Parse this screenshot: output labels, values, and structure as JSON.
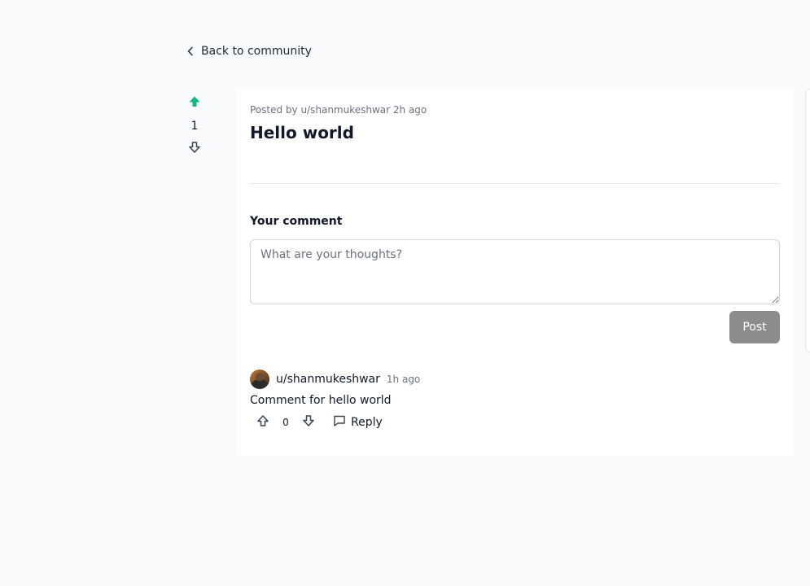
{
  "nav": {
    "back_label": "Back to community"
  },
  "post": {
    "meta": "Posted by u/shanmukeshwar 2h ago",
    "title": "Hello world",
    "votes": "1"
  },
  "comment_form": {
    "label": "Your comment",
    "placeholder": "What are your thoughts?",
    "submit_label": "Post"
  },
  "comments": [
    {
      "user": "u/shanmukeshwar",
      "time": "1h ago",
      "body": "Comment for hello world",
      "votes": "0",
      "reply_label": "Reply"
    }
  ],
  "colors": {
    "accent": "#10b981",
    "page_bg": "#f9fafb",
    "card_bg": "#ffffff",
    "post_button": "#8c8c8c"
  },
  "icons": {
    "back": "chevron-left-icon",
    "upvote_active": "arrow-up-filled-icon",
    "downvote": "arrow-down-outline-icon",
    "reply": "message-square-icon"
  }
}
